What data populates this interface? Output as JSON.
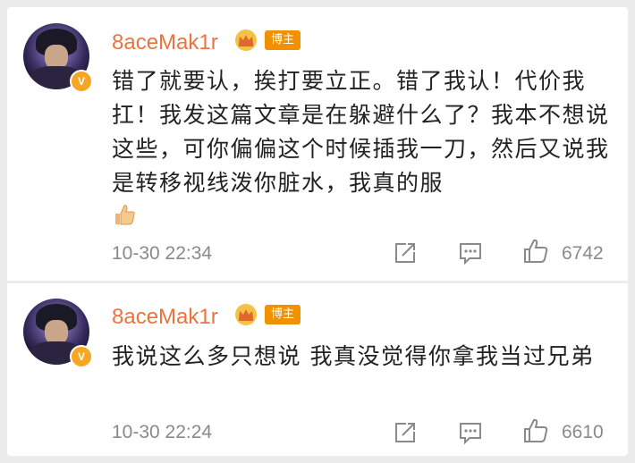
{
  "comments": [
    {
      "username": "8aceMak1r",
      "badge": "博主",
      "text": "错了就要认，挨打要立正。错了我认！代价我扛！我发这篇文章是在躲避什么了？我本不想说这些，可你偏偏这个时候插我一刀，然后又说我是转移视线泼你脏水，我真的服",
      "emoji": "thumbs-up-emoji",
      "timestamp": "10-30 22:34",
      "likes": "6742"
    },
    {
      "username": "8aceMak1r",
      "badge": "博主",
      "text": "我说这么多只想说 我真没觉得你拿我当过兄弟",
      "timestamp": "10-30 22:24",
      "likes": "6610"
    }
  ],
  "icons": {
    "verified": "v-verified-icon",
    "crown": "crown-icon",
    "share": "share-icon",
    "comment": "comment-icon",
    "like": "thumbs-up-icon"
  },
  "colors": {
    "username": "#eb7340",
    "badge": "#f29100",
    "verified": "#f5a623",
    "meta": "#8a8a8a"
  },
  "verified_letter": "V"
}
